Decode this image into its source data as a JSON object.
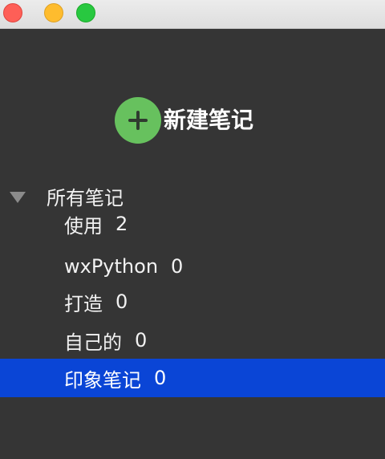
{
  "window": {
    "controls": [
      "close",
      "minimize",
      "maximize"
    ]
  },
  "actions": {
    "new_note_label": "新建笔记",
    "new_note_icon": "plus-circle-icon"
  },
  "sidebar": {
    "root_label": "所有笔记",
    "items": [
      {
        "label": "使用",
        "count": "2",
        "selected": false
      },
      {
        "label": "wxPython",
        "count": "0",
        "selected": false
      },
      {
        "label": "打造",
        "count": "0",
        "selected": false
      },
      {
        "label": "自己的",
        "count": "0",
        "selected": false
      },
      {
        "label": "印象笔记",
        "count": "0",
        "selected": true
      }
    ]
  },
  "colors": {
    "background": "#353535",
    "accent_selected": "#0a45d6",
    "new_note_button": "#67c15e",
    "close": "#fe5f57",
    "minimize": "#febc2e",
    "maximize": "#28c840"
  }
}
